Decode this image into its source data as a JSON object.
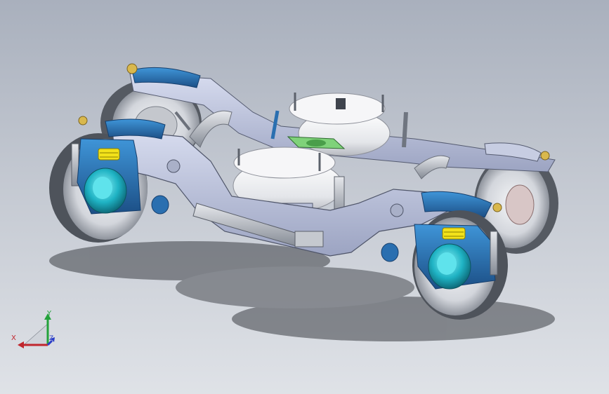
{
  "viewport": {
    "background_top": "#a9b0bd",
    "background_bottom": "#dfe2e7"
  },
  "model": {
    "icon": "railway-bogie-3d-model",
    "colors": {
      "frame": "#b8bfd8",
      "axlebox": "#2a6fb0",
      "bearing_cap": "#1fb3c4",
      "air_spring": "#e9eaee",
      "spring": "#f2e21a",
      "bolster_pad": "#7fd27a",
      "wheel": "#d9dbe0",
      "damper": "#9aa0aa"
    }
  },
  "triad": {
    "icon": "coordinate-axis-triad-icon",
    "x_label": "X",
    "y_label": "Y",
    "z_label": "Z",
    "x_color": "#c0262d",
    "y_color": "#22a23a",
    "z_color": "#2b3ec8"
  }
}
